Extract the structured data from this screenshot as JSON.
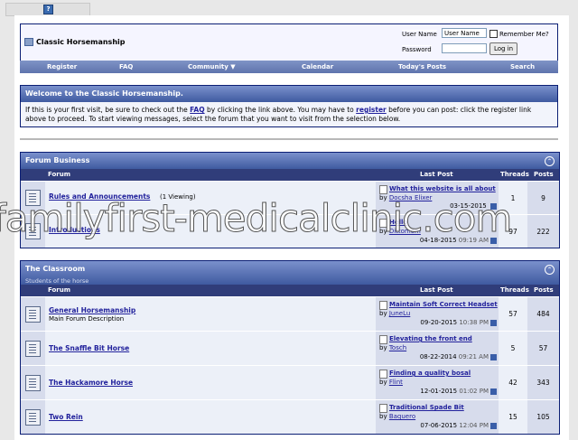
{
  "site": {
    "title": "Classic Horsemanship",
    "help_icon": "?"
  },
  "login": {
    "username_label": "User Name",
    "username_value": "User Name",
    "remember_label": "Remember Me?",
    "password_label": "Password",
    "login_button": "Log in"
  },
  "nav": [
    "Register",
    "FAQ",
    "Community ▼",
    "Calendar",
    "Today's Posts",
    "Search"
  ],
  "welcome": {
    "heading": "Welcome to the Classic Horsemanship.",
    "text_1": "If this is your first visit, be sure to check out the ",
    "faq_link": "FAQ",
    "text_2": " by clicking the link above. You may have to ",
    "register_link": "register",
    "text_3": " before you can post: click the register link above to proceed. To start viewing messages, select the forum that you want to visit from the selection below."
  },
  "columns": {
    "forum": "Forum",
    "last_post": "Last Post",
    "threads": "Threads",
    "posts": "Posts"
  },
  "sections": [
    {
      "title": "Forum Business",
      "subtitle": "",
      "forums": [
        {
          "name": "Rules and Announcements",
          "desc": "(1 Viewing)",
          "last_title": "What this website is all about",
          "by": "Docsha Elixer",
          "date": "03-15-2015",
          "time": "",
          "threads": "1",
          "posts": "9"
        },
        {
          "name": "Introductions",
          "desc": "",
          "last_title": "Hello",
          "by": "Dittomom",
          "date": "04-18-2015",
          "time": "09:19 AM",
          "threads": "97",
          "posts": "222"
        }
      ]
    },
    {
      "title": "The Classroom",
      "subtitle": "Students of the horse",
      "forums": [
        {
          "name": "General Horsemanship",
          "desc": "Main Forum Description",
          "last_title": "Maintain Soft Correct Headset",
          "by": "JuneLu",
          "date": "09-20-2015",
          "time": "10:38 PM",
          "threads": "57",
          "posts": "484"
        },
        {
          "name": "The Snaffle Bit Horse",
          "desc": "",
          "last_title": "Elevating the front end",
          "by": "Tosch",
          "date": "08-22-2014",
          "time": "09:21 AM",
          "threads": "5",
          "posts": "57"
        },
        {
          "name": "The Hackamore Horse",
          "desc": "",
          "last_title": "Finding a quality bosal",
          "by": "Flint",
          "date": "12-01-2015",
          "time": "01:02 PM",
          "threads": "42",
          "posts": "343"
        },
        {
          "name": "Two Rein",
          "desc": "",
          "last_title": "Traditional Spade Bit",
          "by": "Baquero",
          "date": "07-06-2015",
          "time": "12:04 PM",
          "threads": "15",
          "posts": "105"
        }
      ]
    }
  ],
  "by_label": "by",
  "watermark": "familyfirst-medicalclinic.com"
}
